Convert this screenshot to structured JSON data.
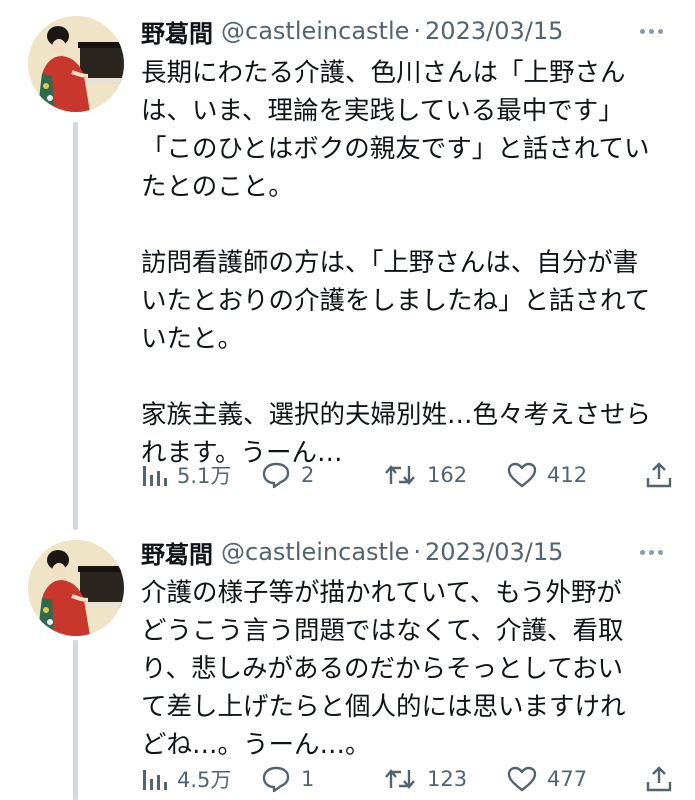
{
  "tweets": [
    {
      "display_name": "野葛間",
      "handle": "@castleincastle",
      "separator": "·",
      "date": "2023/03/15",
      "body_lines": [
        "長期にわたる介護、色川さんは「上野さん",
        "は、いま、理論を実践している最中です」",
        "「このひとはボクの親友です」と話されてい",
        "たとのこと。",
        "",
        "訪問看護師の方は、「上野さんは、自分が書",
        "いたとおりの介護をしましたね」と話されて",
        "いたと。",
        "",
        "家族主義、選択的夫婦別姓…色々考えさせら",
        "れます。うーん…"
      ],
      "stats": {
        "views": "5.1万",
        "replies": "2",
        "retweets": "162",
        "likes": "412"
      }
    },
    {
      "display_name": "野葛間",
      "handle": "@castleincastle",
      "separator": "·",
      "date": "2023/03/15",
      "body_lines": [
        "介護の様子等が描かれていて、もう外野が",
        "どうこう言う問題ではなくて、介護、看取",
        "り、悲しみがあるのだからそっとしておい",
        "て差し上げたらと個人的には思いますけれ",
        "どね…。うーん…。"
      ],
      "stats": {
        "views": "4.5万",
        "replies": "1",
        "retweets": "123",
        "likes": "477"
      }
    }
  ],
  "icons": {
    "views": "bar-chart-icon",
    "reply": "speech-bubble-icon",
    "retweet": "retweet-icon",
    "like": "heart-icon",
    "share": "share-icon",
    "more": "more-dots-icon"
  },
  "colors": {
    "text": "#0f1419",
    "secondary": "#536471",
    "thread_line": "#cfd9de",
    "background": "#ffffff"
  }
}
